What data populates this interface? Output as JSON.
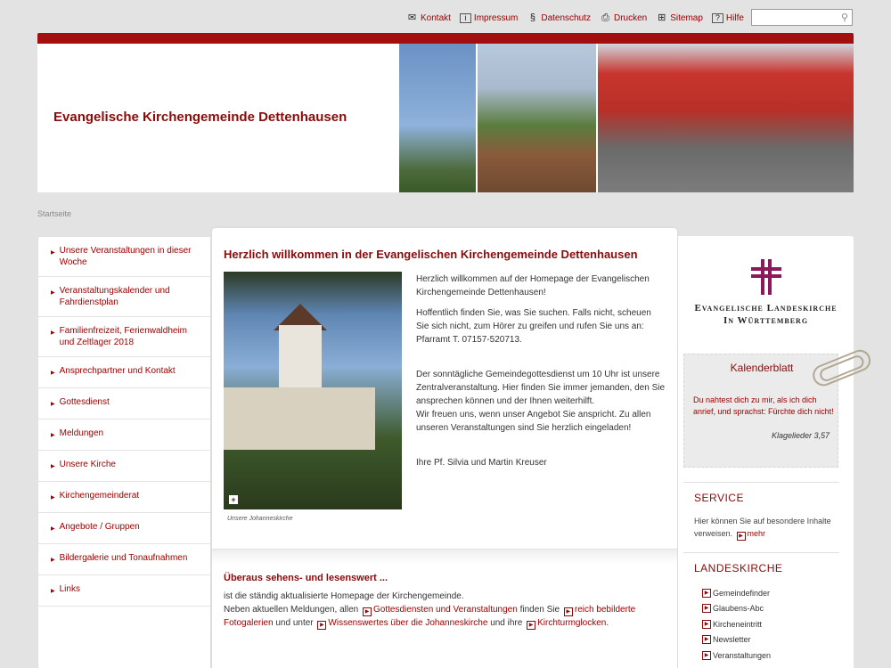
{
  "topbar": {
    "links": [
      {
        "label": "Kontakt",
        "icon": "mail-icon",
        "glyph": "✉"
      },
      {
        "label": "Impressum",
        "icon": "info-icon",
        "glyph": "i"
      },
      {
        "label": "Datenschutz",
        "icon": "section-icon",
        "glyph": "§"
      },
      {
        "label": "Drucken",
        "icon": "printer-icon",
        "glyph": "⎙"
      },
      {
        "label": "Sitemap",
        "icon": "sitemap-icon",
        "glyph": "⊞"
      },
      {
        "label": "Hilfe",
        "icon": "help-icon",
        "glyph": "?"
      }
    ],
    "search_placeholder": ""
  },
  "header": {
    "title": "Evangelische Kirchengemeinde Dettenhausen"
  },
  "breadcrumb": "Startseite",
  "leftnav": {
    "items": [
      "Unsere Veranstaltungen in dieser Woche",
      "Veranstaltungskalender und Fahrdienstplan",
      "Familienfreizeit, Ferienwaldheim und Zeltlager 2018",
      "Ansprechpartner und Kontakt",
      "Gottesdienst",
      "Meldungen",
      "Unsere Kirche",
      "Kirchengemeinderat",
      "Angebote / Gruppen",
      "Bildergalerie und Tonaufnahmen",
      "Links"
    ]
  },
  "main": {
    "heading": "Herzlich willkommen in der Evangelischen Kirchengemeinde Dettenhausen",
    "image_caption": "Unsere Johanneskirche",
    "paragraphs": [
      "Herzlich willkommen auf der Homepage der Evangelischen Kirchengemeinde Dettenhausen!",
      "Hoffentlich finden Sie, was Sie suchen. Falls nicht, scheuen Sie sich nicht, zum Hörer zu greifen und rufen Sie uns an: Pfarramt T. 07157-520713.",
      "",
      "Der sonntägliche Gemeindegottesdienst um 10 Uhr ist unsere Zentralveranstaltung. Hier finden Sie immer jemanden, den Sie ansprechen können und der Ihnen weiterhilft.",
      "Wir freuen uns, wenn unser Angebot Sie anspricht. Zu allen unseren Veranstaltungen sind Sie herzlich eingeladen!",
      "",
      "Ihre Pf. Silvia und Martin Kreuser"
    ],
    "section2": {
      "heading": "Überaus sehens- und lesenswert ...",
      "line1": "ist die ständig aktualisierte Homepage der Kirchengemeinde.",
      "t1": "Neben aktuellen Meldungen, allen",
      "link1": "Gottesdiensten und Veranstaltungen",
      "t2": "finden Sie",
      "link2": "reich bebilderte Fotogalerien",
      "t3": "und unter",
      "link3": "Wissenswertes über die Johanneskirche",
      "t4": "und ihre",
      "link4": "Kirchturmglocken",
      "t5": "."
    }
  },
  "right": {
    "logo_line1": "Evangelische Landeskirche",
    "logo_line2": "In Württemberg",
    "kalender": {
      "title": "Kalenderblatt",
      "verse": "Du nahtest dich zu mir, als ich dich anrief, und sprachst: Fürchte dich nicht!",
      "reference": "Klagelieder 3,57"
    },
    "service": {
      "title": "SERVICE",
      "text": "Hier können Sie auf besondere Inhalte verweisen.",
      "more": "mehr"
    },
    "landeskirche": {
      "title": "LANDESKIRCHE",
      "items": [
        "Gemeindefinder",
        "Glaubens-Abc",
        "Kircheneintritt",
        "Newsletter",
        "Veranstaltungen"
      ]
    }
  },
  "colors": {
    "accent": "#a30f0f",
    "link": "#a00000",
    "cross": "#8b1a5c"
  }
}
